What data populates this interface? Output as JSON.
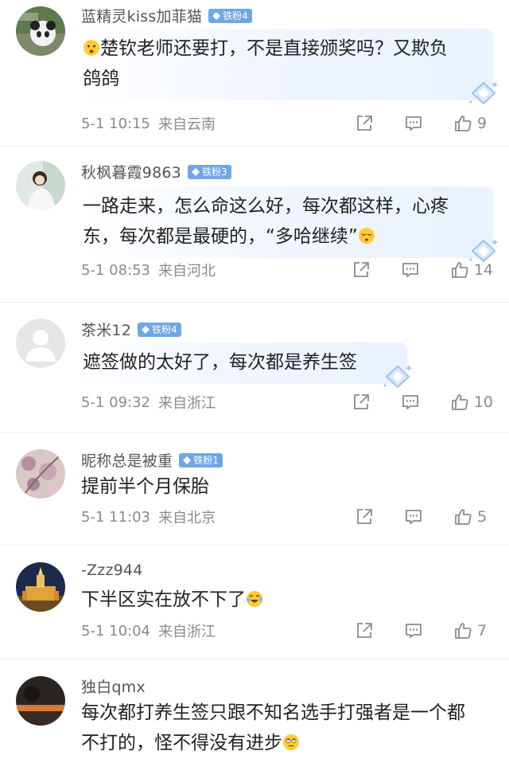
{
  "comments": [
    {
      "user": "蓝精灵kiss加菲猫",
      "badge": "铁粉4",
      "line1": "楚钦老师还要打，不是直接颁奖吗？又欺负",
      "line2": "鸽鸽",
      "time": "5-1 10:15",
      "location": "来自云南",
      "likes": "9"
    },
    {
      "user": "秋枫暮霞9863",
      "badge": "铁粉3",
      "line1": "一路走来，怎么命这么好，每次都这样，心疼",
      "line2": "东，每次都是最硬的，“多哈继续”",
      "time": "5-1 08:53",
      "location": "来自河北",
      "likes": "14"
    },
    {
      "user": "茶米12",
      "badge": "铁粉4",
      "line1": "遮签做的太好了，每次都是养生签",
      "time": "5-1 09:32",
      "location": "来自浙江",
      "likes": "10"
    },
    {
      "user": "昵称总是被重",
      "badge": "铁粉1",
      "line1": "提前半个月保胎",
      "time": "5-1 11:03",
      "location": "来自北京",
      "likes": "5"
    },
    {
      "user": "-Zzz944",
      "line1": "下半区实在放不下了",
      "time": "5-1 10:04",
      "location": "来自浙江",
      "likes": "7"
    },
    {
      "user": "独白qmx",
      "line1": "每次都打养生签只跟不知名选手打强者是一个都",
      "line2": "不打的，怪不得没有进步"
    }
  ],
  "icons": {
    "share": "share-icon",
    "comment": "comment-icon",
    "like": "thumbs-up-icon",
    "badge": "diamond-icon"
  },
  "colors": {
    "badge": "#6fa6e8",
    "meta": "#8a8a8a",
    "bubble": "#e9f2fe"
  }
}
